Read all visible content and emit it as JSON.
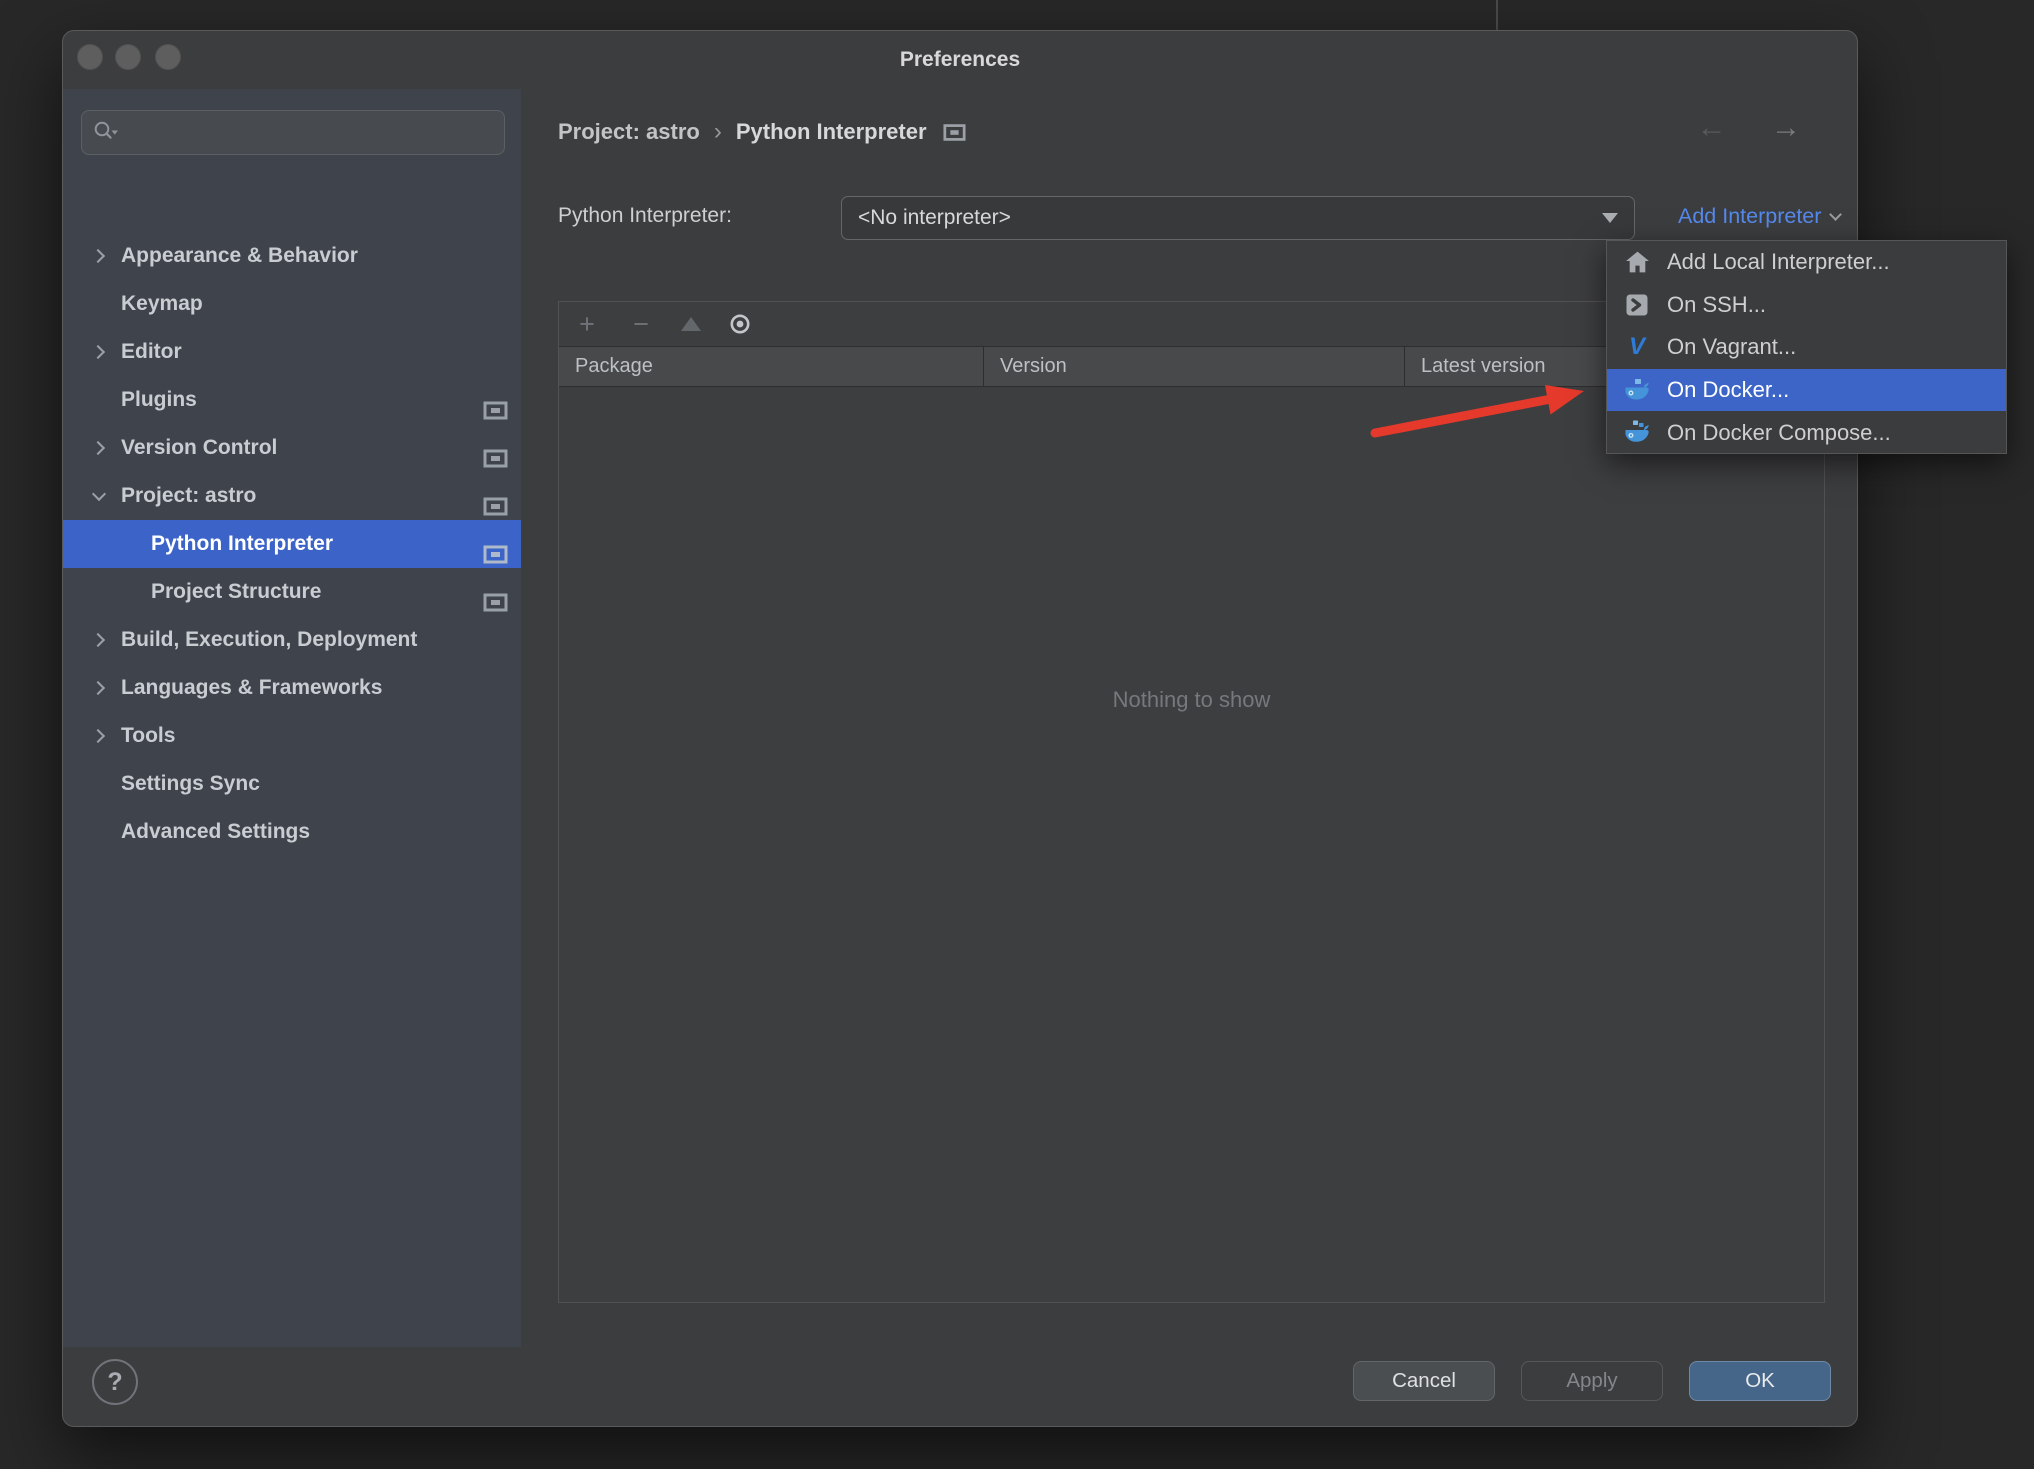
{
  "window": {
    "title": "Preferences"
  },
  "sidebar": {
    "search_placeholder": "",
    "items": [
      {
        "label": "Appearance & Behavior"
      },
      {
        "label": "Keymap"
      },
      {
        "label": "Editor"
      },
      {
        "label": "Plugins"
      },
      {
        "label": "Version Control"
      },
      {
        "label": "Project: astro"
      },
      {
        "label": "Python Interpreter"
      },
      {
        "label": "Project Structure"
      },
      {
        "label": "Build, Execution, Deployment"
      },
      {
        "label": "Languages & Frameworks"
      },
      {
        "label": "Tools"
      },
      {
        "label": "Settings Sync"
      },
      {
        "label": "Advanced Settings"
      }
    ]
  },
  "breadcrumb": {
    "project": "Project: astro",
    "separator": "›",
    "page": "Python Interpreter"
  },
  "nav": {
    "back": "←",
    "forward": "→"
  },
  "interpreter": {
    "label": "Python Interpreter:",
    "value": "<No interpreter>",
    "add_link": "Add Interpreter"
  },
  "add_menu": {
    "items": [
      {
        "label": "Add Local Interpreter...",
        "icon": "home-icon"
      },
      {
        "label": "On SSH...",
        "icon": "ssh-terminal-icon"
      },
      {
        "label": "On Vagrant...",
        "icon": "vagrant-icon",
        "icon_glyph": "V"
      },
      {
        "label": "On Docker...",
        "icon": "docker-icon",
        "highlighted": true
      },
      {
        "label": "On Docker Compose...",
        "icon": "docker-compose-icon"
      }
    ]
  },
  "packages": {
    "toolbar": {
      "add": "+",
      "remove": "−"
    },
    "columns": [
      "Package",
      "Version",
      "Latest version"
    ],
    "rows": [],
    "empty_text": "Nothing to show"
  },
  "footer": {
    "help": "?",
    "cancel": "Cancel",
    "apply": "Apply",
    "ok": "OK"
  },
  "colors": {
    "accent_blue": "#3c64c8",
    "link_blue": "#5689ec",
    "arrow_red": "#e5392b",
    "sidebar_bg": "#3f444c"
  }
}
